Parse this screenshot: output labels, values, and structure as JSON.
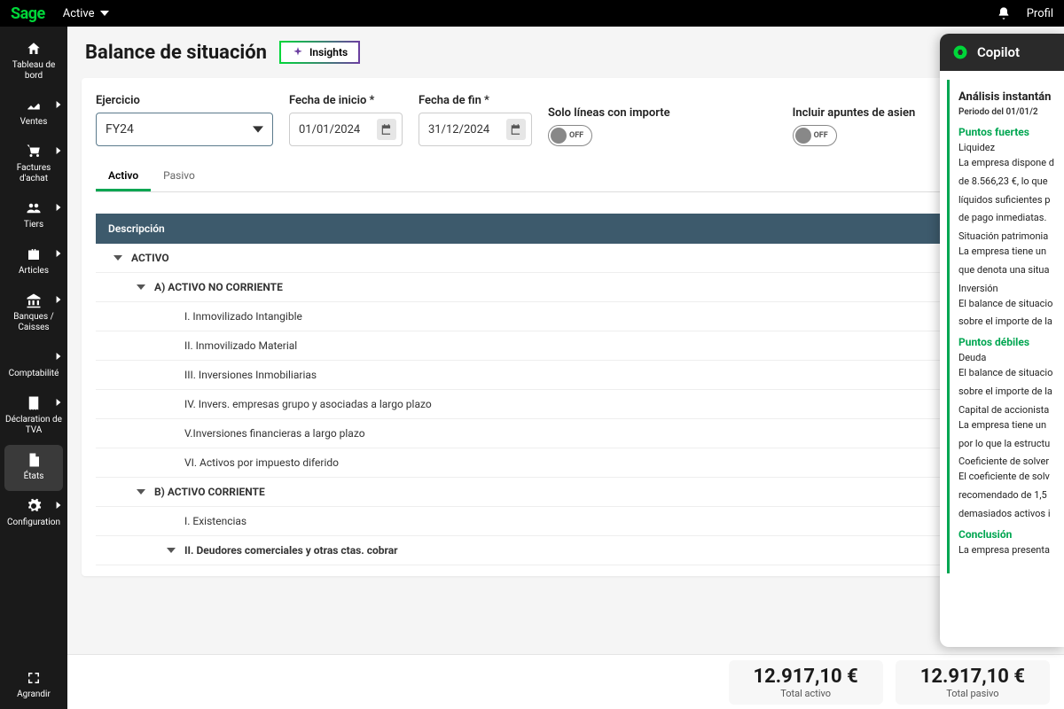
{
  "topbar": {
    "brand": "Sage",
    "workspace": "Active",
    "profile": "Profil"
  },
  "sidebar": {
    "items": [
      {
        "label": "Tableau de bord",
        "icon": "home",
        "chev": false
      },
      {
        "label": "Ventes",
        "icon": "chart",
        "chev": true
      },
      {
        "label": "Factures d'achat",
        "icon": "cart",
        "chev": true
      },
      {
        "label": "Tiers",
        "icon": "users",
        "chev": true
      },
      {
        "label": "Articles",
        "icon": "briefcase",
        "chev": true
      },
      {
        "label": "Banques / Caisses",
        "icon": "bank",
        "chev": true
      },
      {
        "label": "Comptabilité",
        "icon": "ledger",
        "chev": true
      },
      {
        "label": "Déclaration de TVA",
        "icon": "receipt",
        "chev": true
      },
      {
        "label": "États",
        "icon": "doc",
        "chev": false,
        "active": true
      },
      {
        "label": "Configuration",
        "icon": "gear",
        "chev": true
      }
    ],
    "expand": "Agrandir"
  },
  "page": {
    "title": "Balance de situación",
    "insights": "Insights"
  },
  "filters": {
    "ejercicio_label": "Ejercicio",
    "ejercicio_value": "FY24",
    "inicio_label": "Fecha de inicio *",
    "inicio_value": "01/01/2024",
    "fin_label": "Fecha de fin *",
    "fin_value": "31/12/2024",
    "solo_lineas_label": "Solo líneas con importe",
    "incluir_label": "Incluir apuntes de asien",
    "toggle_off": "OFF"
  },
  "tabs": {
    "activo": "Activo",
    "pasivo": "Pasivo"
  },
  "table": {
    "header": "Descripción",
    "rows": [
      {
        "lvl": 0,
        "text": "ACTIVO",
        "chev": true
      },
      {
        "lvl": 1,
        "text": "A) ACTIVO NO CORRIENTE",
        "chev": true
      },
      {
        "lvl": 2,
        "text": "I. Inmovilizado Intangible"
      },
      {
        "lvl": 2,
        "text": "II. Inmovilizado  Material"
      },
      {
        "lvl": 2,
        "text": "III. Inversiones Inmobiliarias"
      },
      {
        "lvl": 2,
        "text": "IV. Invers. empresas grupo y asociadas a largo plazo"
      },
      {
        "lvl": 2,
        "text": "V.Inversiones financieras a largo plazo"
      },
      {
        "lvl": 2,
        "text": "VI. Activos por impuesto diferido"
      },
      {
        "lvl": 1,
        "text": "B) ACTIVO CORRIENTE",
        "chev": true
      },
      {
        "lvl": 2,
        "text": "I. Existencias"
      },
      {
        "lvl": "2b",
        "text": "II. Deudores comerciales y otras ctas. cobrar",
        "chev": true
      }
    ]
  },
  "totals": {
    "activo_val": "12.917,10 €",
    "activo_lbl": "Total activo",
    "pasivo_val": "12.917,10 €",
    "pasivo_lbl": "Total pasivo"
  },
  "copilot": {
    "title": "Copilot",
    "heading": "Análisis instantán",
    "period": "Periodo del 01/01/2",
    "strong_title": "Puntos fuertes",
    "liquidez_h": "Liquidez",
    "liquidez_1": "La empresa dispone d",
    "liquidez_2": "de 8.566,23 €, lo que",
    "liquidez_3": "líquidos suficientes p",
    "liquidez_4": "de pago inmediatas.",
    "situacion_h": "Situación patrimonia",
    "situacion_1": "La empresa tiene un",
    "situacion_2": "que denota una situa",
    "inversion_h": "Inversión",
    "inversion_1": "El balance de situacio",
    "inversion_2": "sobre el importe de la",
    "weak_title": "Puntos débiles",
    "deuda_h": "Deuda",
    "deuda_1": "El balance de situacio",
    "deuda_2": "sobre el importe de la",
    "capital_h": "Capital de accionista",
    "capital_1": "La empresa tiene un",
    "capital_2": "por lo que la estructu",
    "coef_h": "Coeficiente de solver",
    "coef_1": "El coeficiente de solv",
    "coef_2": "recomendado de 1,5",
    "coef_3": "demasiados activos i",
    "conclusion_title": "Conclusión",
    "conclusion_1": "La empresa presenta"
  }
}
